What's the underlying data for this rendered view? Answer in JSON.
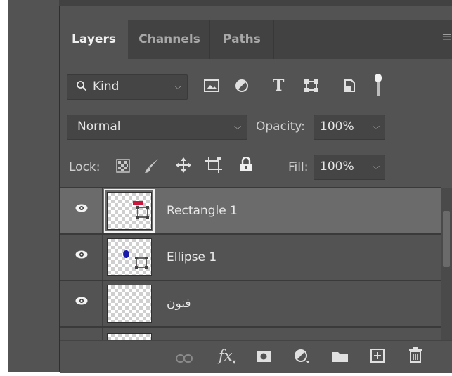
{
  "tabs": [
    {
      "label": "Layers"
    },
    {
      "label": "Channels"
    },
    {
      "label": "Paths"
    }
  ],
  "filter": {
    "label": "Kind"
  },
  "blend": {
    "mode": "Normal",
    "opacity_label": "Opacity:",
    "opacity_value": "100%"
  },
  "lock": {
    "label": "Lock:",
    "fill_label": "Fill:",
    "fill_value": "100%"
  },
  "layers": [
    {
      "name": "Rectangle 1",
      "selected": true
    },
    {
      "name": "Ellipse 1",
      "selected": false
    },
    {
      "name": "فنون",
      "selected": false
    }
  ],
  "colors": {
    "panel_bg": "#535353",
    "selected_row": "#6b6b6b",
    "rect_thumb": "#c8163d",
    "ellipse_thumb": "#1a1aaa"
  },
  "icons": [
    "search-icon",
    "image-filter-icon",
    "adjustment-filter-icon",
    "type-filter-icon",
    "shape-filter-icon",
    "smart-object-filter-icon",
    "filter-toggle-icon",
    "lock-transparent-icon",
    "lock-brush-icon",
    "lock-move-icon",
    "lock-artboard-icon",
    "lock-all-icon",
    "link-icon",
    "fx-icon",
    "mask-icon",
    "adjustment-icon",
    "folder-icon",
    "new-layer-icon",
    "trash-icon",
    "panel-menu-icon"
  ]
}
